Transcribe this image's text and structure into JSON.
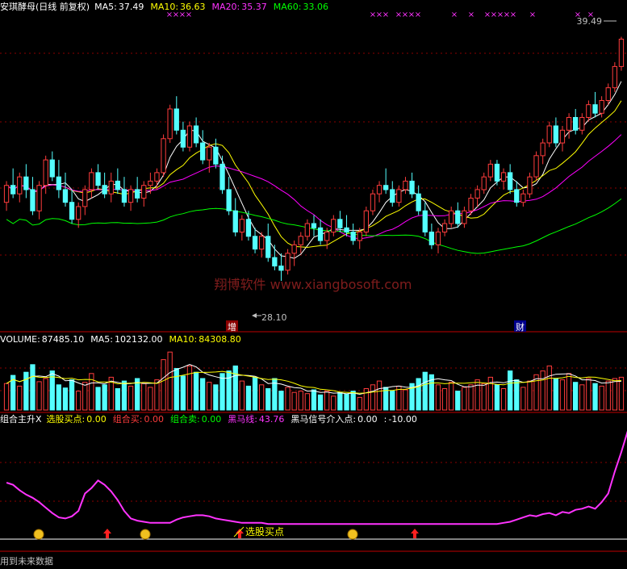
{
  "colors": {
    "up": "#ff3c3c",
    "down": "#54ffff",
    "ma5": "#ffffff",
    "ma10": "#ffff00",
    "ma20": "#ff00ff",
    "ma60": "#00ff00",
    "grid": "#8b0000",
    "divider": "#c00000",
    "magenta": "#ff33ff",
    "text": "#ffffff"
  },
  "panes": {
    "price": {
      "title": "安琪酵母(日线 前复权)",
      "ma": [
        {
          "label": "MA5:",
          "value": "37.49",
          "color": "#ffffff"
        },
        {
          "label": "MA10:",
          "value": "36.63",
          "color": "#ffff00"
        },
        {
          "label": "MA20:",
          "value": "35.37",
          "color": "#ff33ff"
        },
        {
          "label": "MA60:",
          "value": "33.06",
          "color": "#00ff00"
        }
      ],
      "high_label": "39.49",
      "low_label": "28.10",
      "watermark": "翔博软件 www.xiangbosoft.com",
      "marker_zeng": "增",
      "marker_cai": "财",
      "cross_mark": "×"
    },
    "volume": {
      "labels": [
        {
          "label": "VOLUME:",
          "value": "87485.10",
          "color": "#ffffff"
        },
        {
          "label": "MA5:",
          "value": "102132.00",
          "color": "#ffffff"
        },
        {
          "label": "MA10:",
          "value": "84308.80",
          "color": "#ffff00"
        }
      ]
    },
    "indicator": {
      "labels": [
        {
          "label": "组合主升X",
          "value": "",
          "color": "#ffffff"
        },
        {
          "label": "选股买点:",
          "value": "0.00",
          "color": "#ffff00"
        },
        {
          "label": "组合买:",
          "value": "0.00",
          "color": "#ff3c3c"
        },
        {
          "label": "组合卖:",
          "value": "0.00",
          "color": "#00ff00"
        },
        {
          "label": "黑马线:",
          "value": "43.76",
          "color": "#ff33ff"
        },
        {
          "label": "黑马信号介入点:",
          "value": "0.00",
          "color": "#ffffff"
        },
        {
          "label": ":",
          "value": "-10.00",
          "color": "#ffffff"
        }
      ],
      "buy_point_label": "选股买点",
      "footer": "用到未来数据"
    }
  },
  "chart_data": {
    "type": "candlestick",
    "price_range": [
      26.2,
      40.8
    ],
    "volume_range": [
      0,
      170000
    ],
    "indicator_range": [
      -12,
      92
    ],
    "candles": [
      [
        31.8,
        32.8,
        31.4,
        32.6
      ],
      [
        32.6,
        33.4,
        32.0,
        32.2
      ],
      [
        32.2,
        33.2,
        31.8,
        33.0
      ],
      [
        33.0,
        33.6,
        32.0,
        32.4
      ],
      [
        32.4,
        33.0,
        31.2,
        31.4
      ],
      [
        31.4,
        32.8,
        31.0,
        32.6
      ],
      [
        32.6,
        34.0,
        32.2,
        33.8
      ],
      [
        33.8,
        34.2,
        32.8,
        33.0
      ],
      [
        33.0,
        33.8,
        32.0,
        32.4
      ],
      [
        32.4,
        33.2,
        31.6,
        31.8
      ],
      [
        31.8,
        32.4,
        30.8,
        31.0
      ],
      [
        31.0,
        31.8,
        30.6,
        31.6
      ],
      [
        31.6,
        32.6,
        31.2,
        32.4
      ],
      [
        32.4,
        33.4,
        32.0,
        33.2
      ],
      [
        33.2,
        33.6,
        32.4,
        32.6
      ],
      [
        32.6,
        33.2,
        32.0,
        32.2
      ],
      [
        32.2,
        33.2,
        31.8,
        32.8
      ],
      [
        32.8,
        33.4,
        32.2,
        32.4
      ],
      [
        32.4,
        33.0,
        31.6,
        31.8
      ],
      [
        31.8,
        32.6,
        31.4,
        32.4
      ],
      [
        32.4,
        33.0,
        31.8,
        32.0
      ],
      [
        32.0,
        32.8,
        31.6,
        32.6
      ],
      [
        32.6,
        33.2,
        32.2,
        32.8
      ],
      [
        32.8,
        33.4,
        32.4,
        33.2
      ],
      [
        33.2,
        35.0,
        33.0,
        34.8
      ],
      [
        34.8,
        36.4,
        34.6,
        36.2
      ],
      [
        36.2,
        36.8,
        35.0,
        35.2
      ],
      [
        35.2,
        35.6,
        34.2,
        34.4
      ],
      [
        34.4,
        35.6,
        34.2,
        35.4
      ],
      [
        35.4,
        35.8,
        34.4,
        34.6
      ],
      [
        34.6,
        35.2,
        33.6,
        33.8
      ],
      [
        33.8,
        34.6,
        33.2,
        34.4
      ],
      [
        34.4,
        34.8,
        33.4,
        33.6
      ],
      [
        33.6,
        34.0,
        32.2,
        32.4
      ],
      [
        32.4,
        33.0,
        31.2,
        31.4
      ],
      [
        31.4,
        32.0,
        30.2,
        30.4
      ],
      [
        30.4,
        31.2,
        30.0,
        31.0
      ],
      [
        31.0,
        31.4,
        30.0,
        30.2
      ],
      [
        30.2,
        30.6,
        29.4,
        29.6
      ],
      [
        29.6,
        30.4,
        29.2,
        30.2
      ],
      [
        30.2,
        30.8,
        29.0,
        29.2
      ],
      [
        29.2,
        29.8,
        28.6,
        28.8
      ],
      [
        28.8,
        29.4,
        28.1,
        28.6
      ],
      [
        28.6,
        29.6,
        28.4,
        29.4
      ],
      [
        29.4,
        30.0,
        28.8,
        29.8
      ],
      [
        29.8,
        30.4,
        29.4,
        30.2
      ],
      [
        30.2,
        31.0,
        30.0,
        30.8
      ],
      [
        30.8,
        31.2,
        30.2,
        30.6
      ],
      [
        30.6,
        31.0,
        29.8,
        30.0
      ],
      [
        30.0,
        30.6,
        29.6,
        30.4
      ],
      [
        30.4,
        31.2,
        30.2,
        31.0
      ],
      [
        31.0,
        31.4,
        30.4,
        30.6
      ],
      [
        30.6,
        31.2,
        30.2,
        30.4
      ],
      [
        30.4,
        30.8,
        29.8,
        30.0
      ],
      [
        30.0,
        30.6,
        29.6,
        30.4
      ],
      [
        30.4,
        31.6,
        30.2,
        31.4
      ],
      [
        31.4,
        32.4,
        31.2,
        32.2
      ],
      [
        32.2,
        32.8,
        31.8,
        32.6
      ],
      [
        32.6,
        33.4,
        32.2,
        32.4
      ],
      [
        32.4,
        32.8,
        31.6,
        31.8
      ],
      [
        31.8,
        32.6,
        31.6,
        32.4
      ],
      [
        32.4,
        33.0,
        32.2,
        32.8
      ],
      [
        32.8,
        33.2,
        32.0,
        32.2
      ],
      [
        32.2,
        32.6,
        31.2,
        31.4
      ],
      [
        31.4,
        31.8,
        30.2,
        30.4
      ],
      [
        30.4,
        30.8,
        29.6,
        29.8
      ],
      [
        29.8,
        30.6,
        29.4,
        30.4
      ],
      [
        30.4,
        31.0,
        30.2,
        30.8
      ],
      [
        30.8,
        31.6,
        30.6,
        31.4
      ],
      [
        31.4,
        31.8,
        30.6,
        30.8
      ],
      [
        30.8,
        31.6,
        30.6,
        31.4
      ],
      [
        31.4,
        32.2,
        31.2,
        32.0
      ],
      [
        32.0,
        32.6,
        31.6,
        32.4
      ],
      [
        32.4,
        33.2,
        32.2,
        33.0
      ],
      [
        33.0,
        33.8,
        32.8,
        33.6
      ],
      [
        33.6,
        33.8,
        32.6,
        32.8
      ],
      [
        32.8,
        33.4,
        32.4,
        33.2
      ],
      [
        33.2,
        33.6,
        32.2,
        32.4
      ],
      [
        32.4,
        32.8,
        31.6,
        31.8
      ],
      [
        31.8,
        32.4,
        31.6,
        32.2
      ],
      [
        32.2,
        33.2,
        32.0,
        33.0
      ],
      [
        33.0,
        34.2,
        32.8,
        34.0
      ],
      [
        34.0,
        34.8,
        33.6,
        34.6
      ],
      [
        34.6,
        35.6,
        34.4,
        35.4
      ],
      [
        35.4,
        35.8,
        34.4,
        34.6
      ],
      [
        34.6,
        35.4,
        34.2,
        35.2
      ],
      [
        35.2,
        36.0,
        34.8,
        35.8
      ],
      [
        35.8,
        36.2,
        35.0,
        35.2
      ],
      [
        35.2,
        36.0,
        35.0,
        35.8
      ],
      [
        35.8,
        36.6,
        35.6,
        36.4
      ],
      [
        36.4,
        37.0,
        35.8,
        36.0
      ],
      [
        36.0,
        36.8,
        35.8,
        36.6
      ],
      [
        36.6,
        37.4,
        36.4,
        37.2
      ],
      [
        37.2,
        38.4,
        37.0,
        38.2
      ],
      [
        38.2,
        39.6,
        38.0,
        39.49
      ]
    ],
    "volume_seed": [
      0.42,
      0.55,
      0.38,
      0.6,
      0.72,
      0.45,
      0.5,
      0.62,
      0.4,
      0.35,
      0.48,
      0.3,
      0.44,
      0.58,
      0.36,
      0.4,
      0.52,
      0.34,
      0.46,
      0.38,
      0.5,
      0.42,
      0.36,
      0.48,
      0.8,
      0.92,
      0.66,
      0.54,
      0.7,
      0.6,
      0.5,
      0.44,
      0.4,
      0.58,
      0.62,
      0.7,
      0.46,
      0.38,
      0.52,
      0.4,
      0.34,
      0.5,
      0.3,
      0.36,
      0.28,
      0.3,
      0.26,
      0.32,
      0.24,
      0.3,
      0.22,
      0.28,
      0.25,
      0.3,
      0.2,
      0.34,
      0.4,
      0.46,
      0.36,
      0.3,
      0.38,
      0.32,
      0.42,
      0.5,
      0.6,
      0.56,
      0.4,
      0.34,
      0.44,
      0.3,
      0.36,
      0.4,
      0.48,
      0.42,
      0.52,
      0.4,
      0.34,
      0.62,
      0.48,
      0.36,
      0.46,
      0.56,
      0.62,
      0.7,
      0.5,
      0.48,
      0.58,
      0.44,
      0.4,
      0.5,
      0.42,
      0.38,
      0.46,
      0.5,
      0.52
    ],
    "black_horse_line": [
      40,
      38,
      33,
      29,
      26,
      22,
      17,
      12,
      8,
      7,
      9,
      14,
      30,
      35,
      42,
      38,
      32,
      24,
      14,
      7,
      5,
      4,
      3,
      3,
      3,
      3,
      6,
      8,
      9,
      10,
      10,
      9,
      7,
      6,
      5,
      4,
      3,
      3,
      3,
      3,
      2,
      2,
      2,
      2,
      2,
      2,
      2,
      2,
      2,
      2,
      2,
      2,
      2,
      2,
      2,
      2,
      2,
      2,
      2,
      2,
      2,
      2,
      2,
      2,
      2,
      2,
      2,
      2,
      2,
      2,
      2,
      2,
      2,
      2,
      2,
      2,
      3,
      4,
      6,
      8,
      10,
      9,
      11,
      12,
      10,
      13,
      12,
      15,
      16,
      18,
      16,
      22,
      30,
      50,
      68,
      88
    ]
  }
}
